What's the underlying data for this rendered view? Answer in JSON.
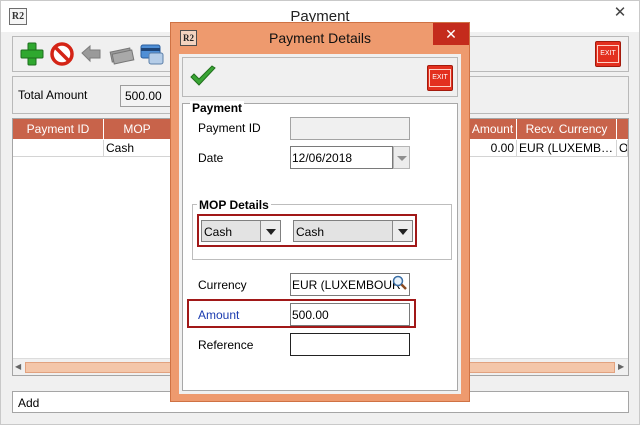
{
  "outer": {
    "logo_text": "R2",
    "title": "Payment",
    "close_glyph": "✕",
    "total_label": "Total Amount",
    "total_value": "500.00",
    "exit_label": "EXIT",
    "status_text": "Add"
  },
  "grid": {
    "headers": [
      "Payment ID",
      "MOP",
      "Amount",
      "Recv. Currency"
    ],
    "row": {
      "mop": "Cash",
      "amount": "0.00",
      "currency": "EUR (LUXEMB…",
      "next_cell": "O"
    }
  },
  "dialog": {
    "logo_text": "R2",
    "title": "Payment Details",
    "close_glyph": "✕",
    "exit_label": "EXIT",
    "payment_group_label": "Payment",
    "payment_id_label": "Payment ID",
    "payment_id_value": "",
    "date_label": "Date",
    "date_value": "12/06/2018",
    "mop_group_label": "MOP Details",
    "mop_type": "Cash",
    "mop_subtype": "Cash",
    "currency_label": "Currency",
    "currency_value": "EUR (LUXEMBOUR",
    "amount_label": "Amount",
    "amount_value": "500.00",
    "reference_label": "Reference",
    "reference_value": ""
  },
  "colors": {
    "grid_header": "#c8634a",
    "dialog_frame": "#ee9a6e",
    "highlight_border": "#a11818",
    "amount_label": "#1a3bb0"
  }
}
